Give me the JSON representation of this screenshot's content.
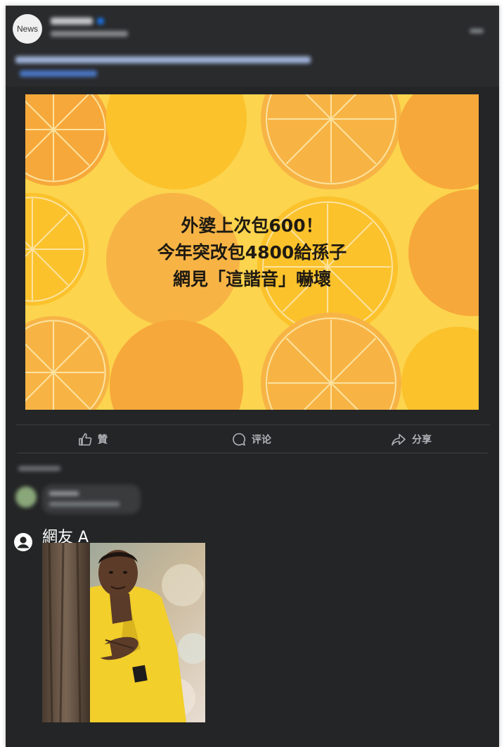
{
  "header": {
    "logo_text": "News"
  },
  "post_image": {
    "headline_lines": [
      "外婆上次包600！",
      "今年突改包4800給孫子",
      "網見「這諧音」嚇壞"
    ]
  },
  "actions": {
    "like_label": "贊",
    "comment_label": "评论",
    "share_label": "分享"
  },
  "reply": {
    "username": "網友 A"
  },
  "colors": {
    "card_background": "#242526",
    "image_background": "#fcd44e",
    "action_text": "#b0b3b8",
    "meme_jacket": "#f2cf2a"
  }
}
